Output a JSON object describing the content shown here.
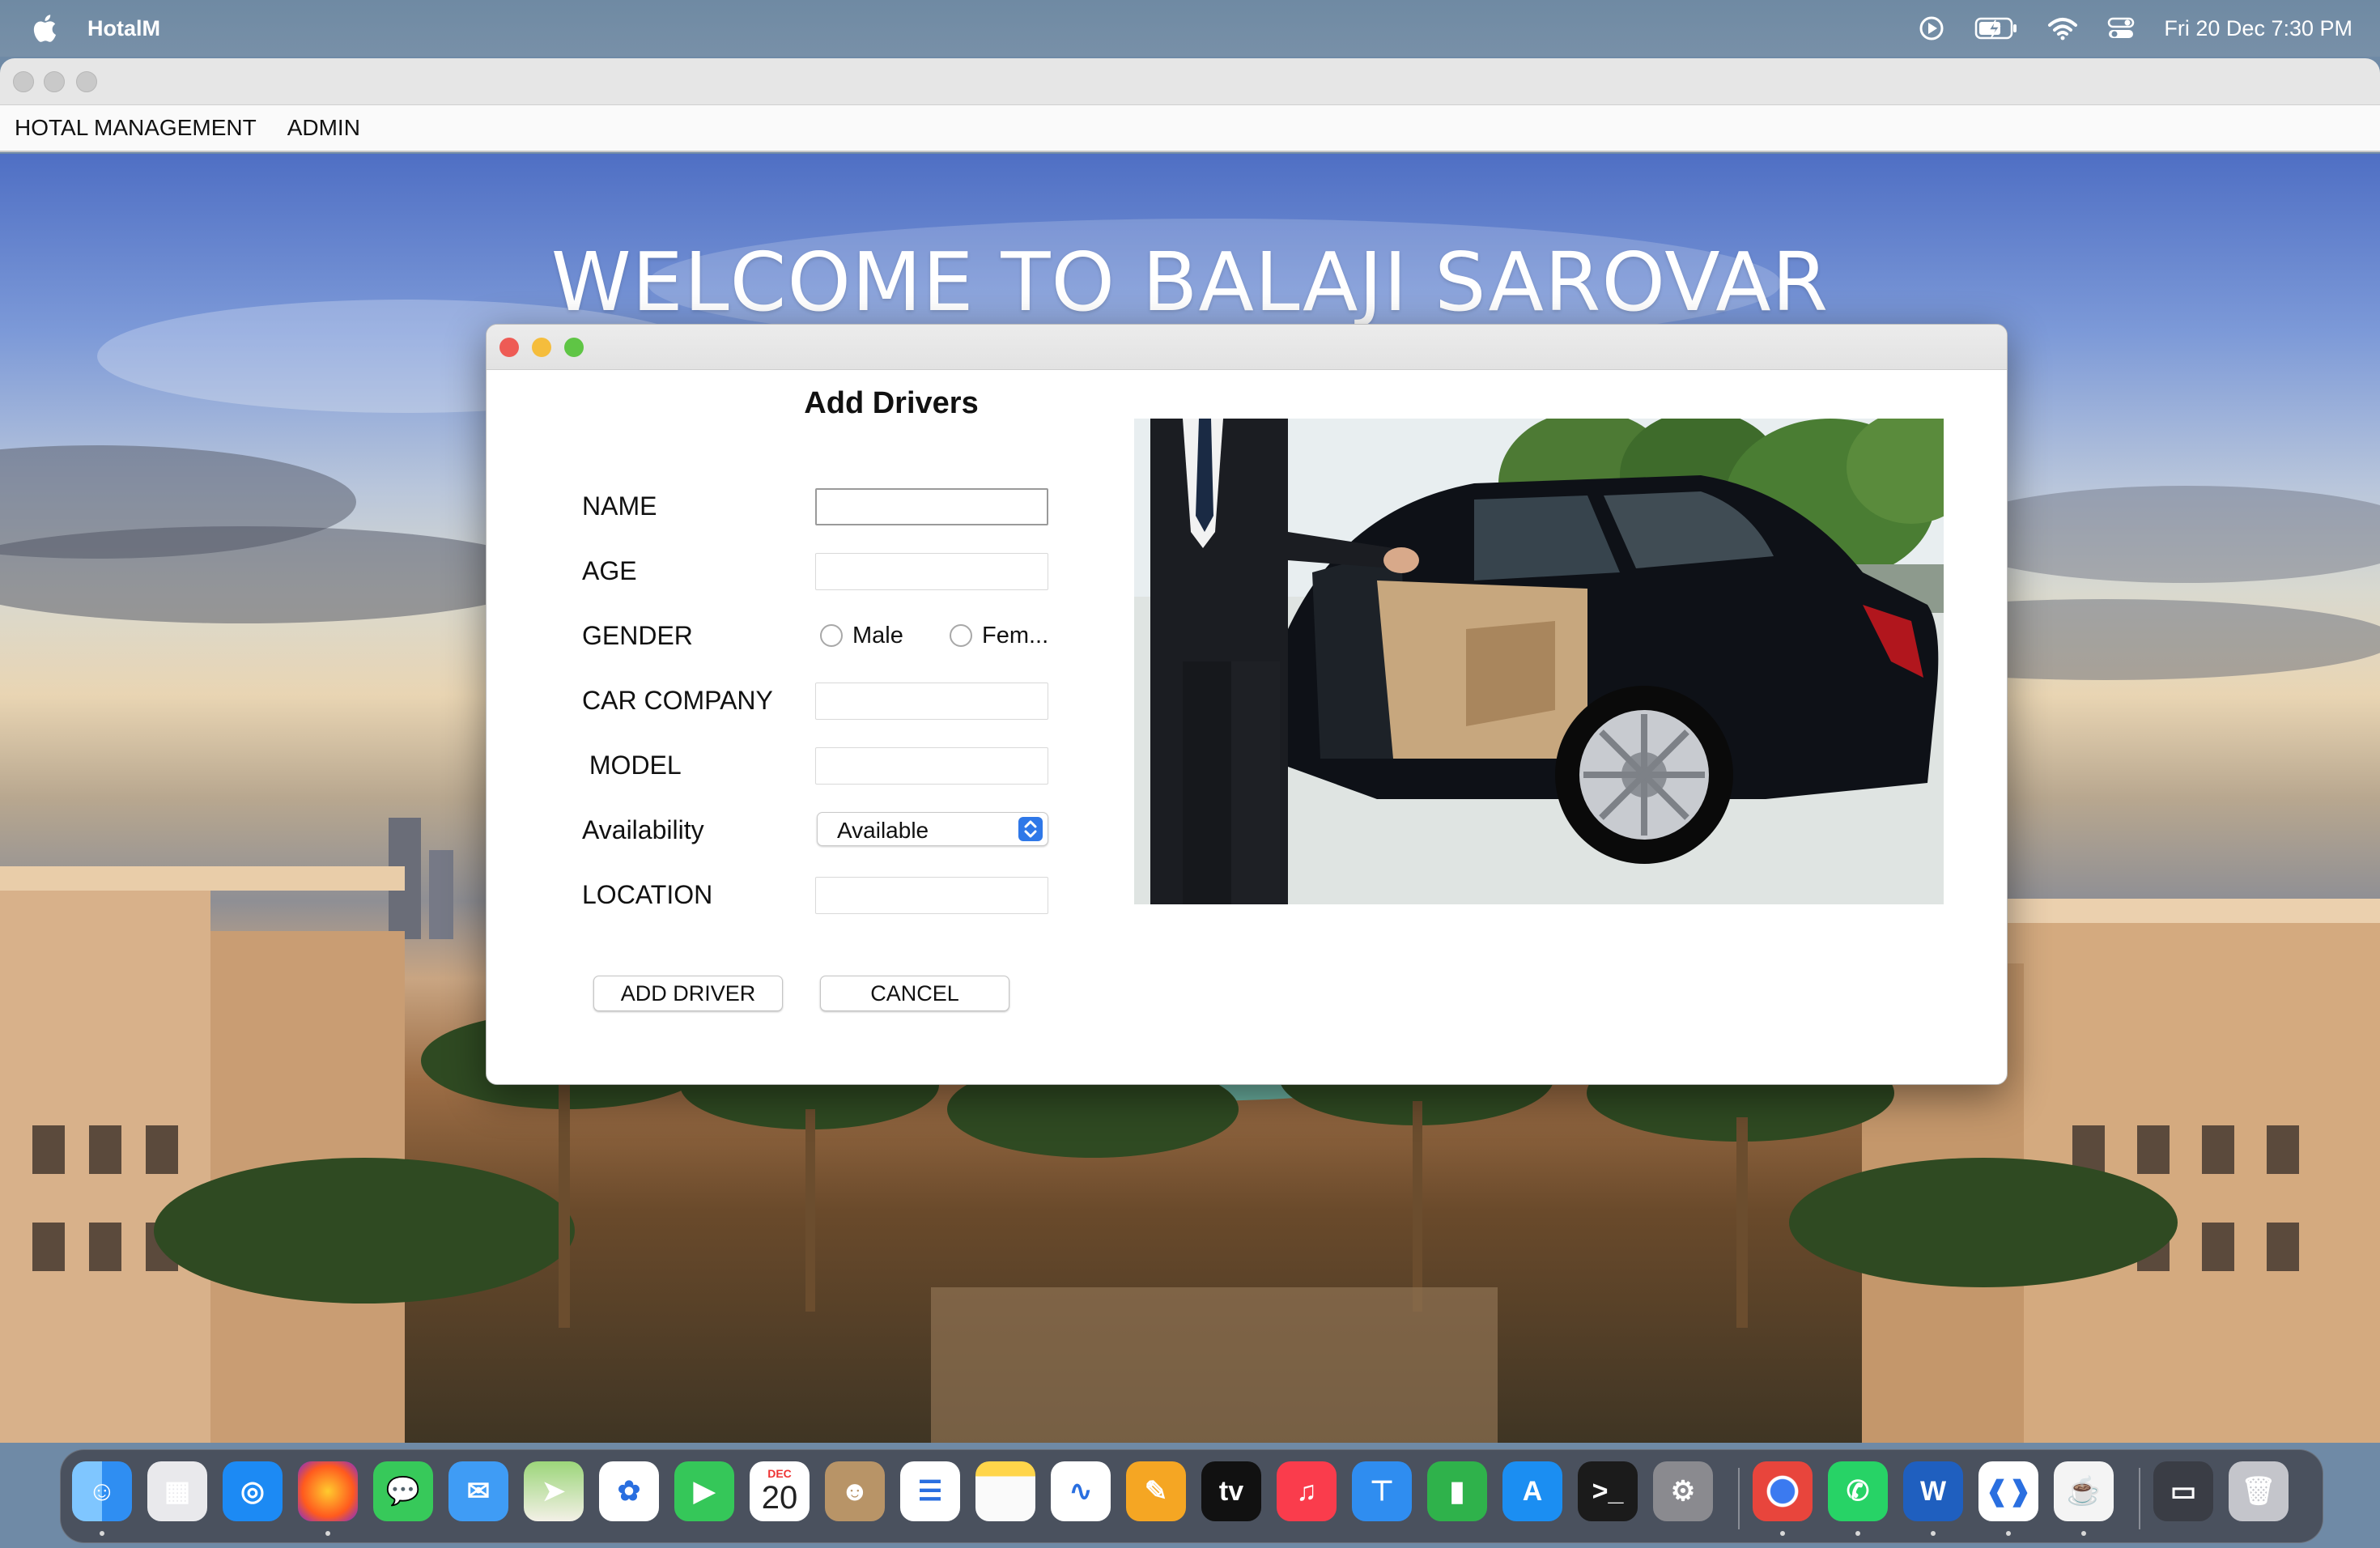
{
  "menubar": {
    "app_name": "HotalM",
    "clock": "Fri 20 Dec  7:30 PM",
    "status_icons": [
      "play-circle-icon",
      "battery-charging-icon",
      "wifi-icon",
      "control-center-icon"
    ]
  },
  "app_menu": {
    "items": [
      "HOTAL MANAGEMENT",
      "ADMIN"
    ]
  },
  "background": {
    "welcome_text": "WELCOME TO BALAJI SAROVAR"
  },
  "dialog": {
    "title": "Add Drivers",
    "fields": {
      "name_label": "NAME",
      "age_label": "AGE",
      "gender_label": "GENDER",
      "car_company_label": "CAR COMPANY",
      "model_label": " MODEL",
      "availability_label": "Availability",
      "location_label": "LOCATION",
      "name_value": "",
      "age_value": "",
      "car_company_value": "",
      "model_value": "",
      "location_value": ""
    },
    "gender_options": {
      "male": "Male",
      "female": "Fem..."
    },
    "availability_selected": "Available",
    "buttons": {
      "add": "ADD DRIVER",
      "cancel": "CANCEL"
    },
    "traffic_colors": {
      "close": "#ee5b55",
      "minimize": "#f5bd3c",
      "zoom": "#5fc545"
    }
  },
  "dock": {
    "calendar_month": "DEC",
    "calendar_day": "20",
    "apps": [
      "finder-icon",
      "launchpad-icon",
      "safari-icon",
      "firefox-icon",
      "messages-icon",
      "mail-icon",
      "maps-icon",
      "photos-icon",
      "facetime-icon",
      "calendar-icon",
      "contacts-icon",
      "reminders-icon",
      "notes-icon",
      "freeform-icon",
      "pages-icon",
      "apple-tv-icon",
      "music-icon",
      "keynote-icon",
      "numbers-icon",
      "app-store-icon",
      "terminal-icon",
      "system-settings-icon",
      "chrome-icon",
      "whatsapp-icon",
      "word-icon",
      "vscode-icon",
      "java-icon",
      "downloads-stack-icon",
      "trash-icon"
    ]
  }
}
